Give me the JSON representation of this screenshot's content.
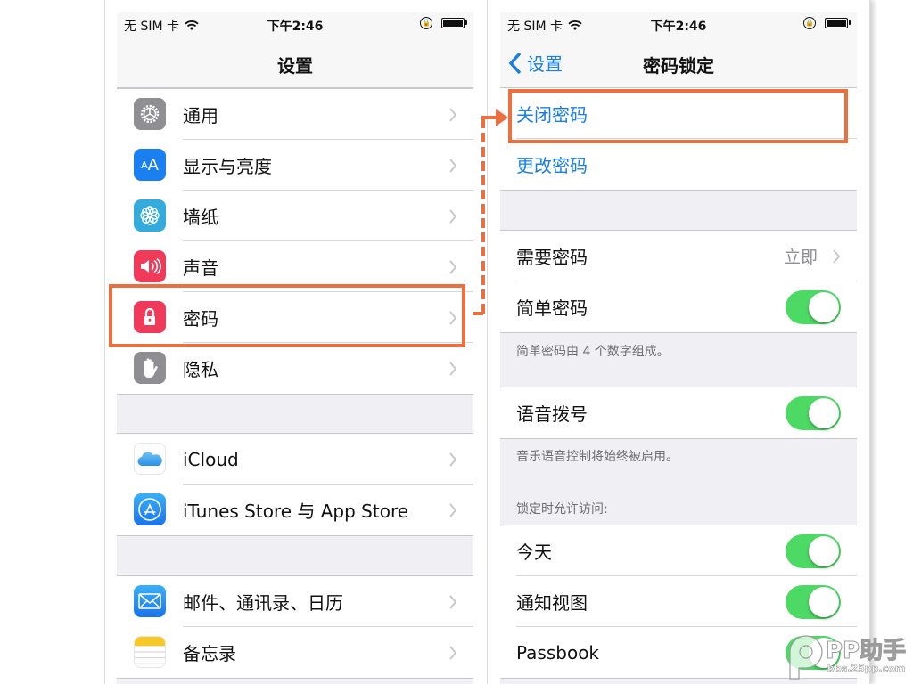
{
  "status_bar": {
    "carrier": "无 SIM 卡",
    "time": "下午2:46",
    "wifi_icon": "wifi-icon",
    "rotation_lock_icon": "rotation-lock-icon",
    "battery_icon": "battery-icon"
  },
  "left_screen": {
    "title": "设置",
    "groups": [
      [
        {
          "label": "通用",
          "icon": "gear-icon",
          "color": "#8e8e93"
        },
        {
          "label": "显示与亮度",
          "icon": "text-size-icon",
          "color": "#1a7ff0",
          "glyph": "AA"
        },
        {
          "label": "墙纸",
          "icon": "flower-icon",
          "color": "#35aadc"
        },
        {
          "label": "声音",
          "icon": "speaker-icon",
          "color": "#f03a5a"
        },
        {
          "label": "密码",
          "icon": "lock-icon",
          "color": "#f03a5a"
        },
        {
          "label": "隐私",
          "icon": "hand-icon",
          "color": "#8e8e93"
        }
      ],
      [
        {
          "label": "iCloud",
          "icon": "cloud-icon",
          "color": "#ffffff"
        },
        {
          "label": "iTunes Store 与 App Store",
          "icon": "app-store-icon",
          "color": "#1d8cf2"
        }
      ],
      [
        {
          "label": "邮件、通讯录、日历",
          "icon": "mail-icon",
          "color": "#1d8cf2"
        },
        {
          "label": "备忘录",
          "icon": "notes-icon",
          "color": "#ffffff"
        }
      ]
    ]
  },
  "right_screen": {
    "back_label": "设置",
    "title": "密码锁定",
    "actions": [
      "关闭密码",
      "更改密码"
    ],
    "require_passcode": {
      "label": "需要密码",
      "value": "立即"
    },
    "simple_passcode": {
      "label": "简单密码",
      "on": true
    },
    "simple_passcode_note": "简单密码由 4 个数字组成。",
    "voice_dial": {
      "label": "语音拨号",
      "on": true
    },
    "voice_dial_note": "音乐语音控制将始终被启用。",
    "lock_access_header": "锁定时允许访问:",
    "lock_access_items": [
      {
        "label": "今天",
        "on": true
      },
      {
        "label": "通知视图",
        "on": true
      },
      {
        "label": "Passbook",
        "on": true
      }
    ]
  },
  "annotation": {
    "highlight_color": "#ec6f3f",
    "from": "密码",
    "to": "关闭密码"
  },
  "watermark": {
    "brand": "PP助手",
    "url": "bbs.25pp.com"
  }
}
